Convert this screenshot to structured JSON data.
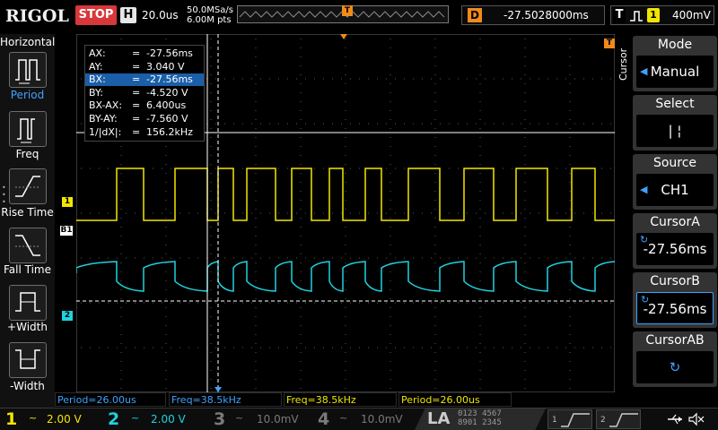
{
  "header": {
    "logo": "RIGOL",
    "run_state": "STOP",
    "timebase_badge": "H",
    "timebase": "20.0us",
    "sample_rate": "50.0MSa/s",
    "memory_depth": "6.00M pts",
    "trigger_position_badge": "T",
    "delay_badge": "D",
    "delay": "-27.5028000ms",
    "trigger_type_badge": "T",
    "trigger_source_badge": "1",
    "trigger_level": "400mV"
  },
  "left_panel": {
    "title": "Horizontal",
    "items": [
      {
        "label": "Period",
        "icon": "period-icon"
      },
      {
        "label": "Freq",
        "icon": "freq-icon"
      },
      {
        "label": "Rise Time",
        "icon": "rise-time-icon"
      },
      {
        "label": "Fall Time",
        "icon": "fall-time-icon"
      },
      {
        "label": "+Width",
        "icon": "positive-width-icon"
      },
      {
        "label": "-Width",
        "icon": "negative-width-icon"
      }
    ]
  },
  "cursor_readout": [
    {
      "name": "AX:",
      "eq": "=",
      "value": "-27.56ms"
    },
    {
      "name": "AY:",
      "eq": "=",
      "value": "3.040 V"
    },
    {
      "name": "BX:",
      "eq": "=",
      "value": "-27.56ms"
    },
    {
      "name": "BY:",
      "eq": "=",
      "value": "-4.520 V"
    },
    {
      "name": "BX-AX:",
      "eq": "=",
      "value": "6.400us"
    },
    {
      "name": "BY-AY:",
      "eq": "=",
      "value": "-7.560 V"
    },
    {
      "name": "1/|dX|:",
      "eq": "=",
      "value": "156.2kHz"
    }
  ],
  "markers": {
    "ch1": "1",
    "ch2": "2",
    "b1": "B1",
    "trigger_level": "T",
    "trigger_top": "T"
  },
  "measurements": [
    {
      "text": "Period=26.00us",
      "color": "#3ea3ff"
    },
    {
      "text": "Freq=38.5kHz",
      "color": "#3ea3ff"
    },
    {
      "text": "Freq=38.5kHz",
      "color": "#f2e600"
    },
    {
      "text": "Period=26.00us",
      "color": "#f2e600"
    }
  ],
  "channels": [
    {
      "num": "1",
      "coupling": "~",
      "scale": "2.00 V",
      "color": "#f2e600"
    },
    {
      "num": "2",
      "coupling": "~",
      "scale": "2.00 V",
      "color": "#1fd2e0"
    },
    {
      "num": "3",
      "coupling": "~",
      "scale": "10.0mV",
      "color": "#7a7a7a"
    },
    {
      "num": "4",
      "coupling": "~",
      "scale": "10.0mV",
      "color": "#7a7a7a"
    }
  ],
  "la": {
    "label": "LA",
    "bits_top": "0123 4567",
    "bits_bottom": "8901 2345",
    "d1_label": "1",
    "d2_label": "2"
  },
  "right_menu": {
    "vertical_title": "Cursor",
    "items": [
      {
        "title": "Mode",
        "value": "Manual"
      },
      {
        "title": "Select",
        "value": "|   ¦"
      },
      {
        "title": "Source",
        "value": "CH1"
      },
      {
        "title": "CursorA",
        "value": "-27.56ms"
      },
      {
        "title": "CursorB",
        "value": "-27.56ms"
      },
      {
        "title": "CursorAB",
        "value": "↻"
      }
    ]
  },
  "colors": {
    "ch1": "#f2e600",
    "ch2": "#1fd2e0",
    "accent": "#3ea3ff",
    "trigger": "#f08a1c",
    "stop": "#d9383a"
  }
}
